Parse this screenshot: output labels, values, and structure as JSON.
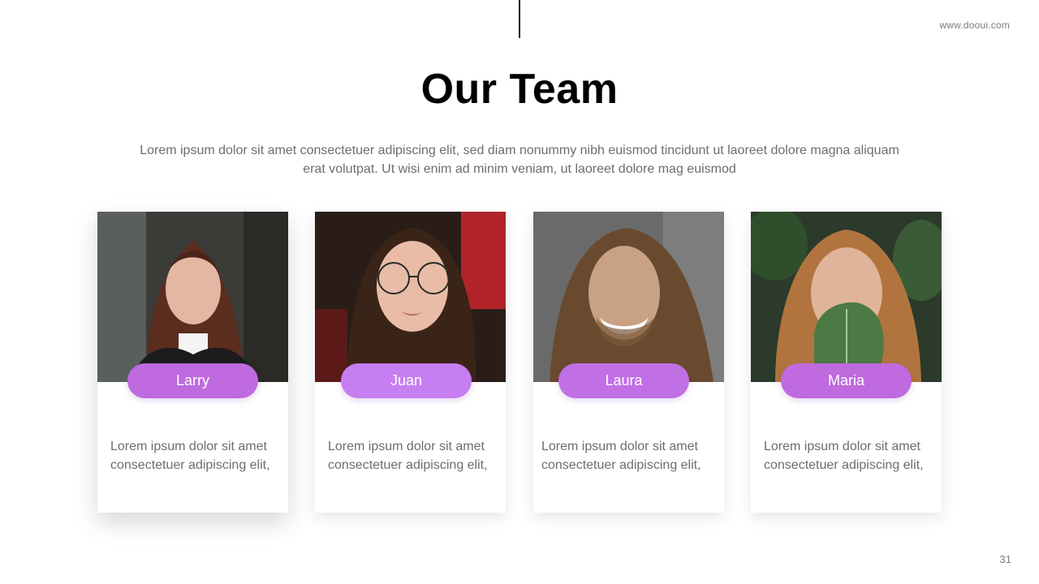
{
  "header": {
    "site_url": "www.dooui.com",
    "title": "Our Team",
    "intro_line1": "Lorem ipsum dolor sit amet consectetuer  adipiscing elit, sed diam nonummy  nibh euismod tincidunt  ut laoreet dolore magna aliquam",
    "intro_line2": "erat volutpat.  Ut wisi enim ad minim veniam,  ut laoreet dolore mag euismod"
  },
  "team": [
    {
      "name": "Larry",
      "desc_line1": "Lorem  ipsum  dolor  sit  amet",
      "desc_line2": "consectetuer  adipiscing elit,"
    },
    {
      "name": "Juan",
      "desc_line1": "Lorem  ipsum  dolor  sit  amet",
      "desc_line2": "consectetuer  adipiscing elit,"
    },
    {
      "name": "Laura",
      "desc_line1": "Lorem  ipsum  dolor  sit  amet",
      "desc_line2": "consectetuer  adipiscing elit,"
    },
    {
      "name": "Maria",
      "desc_line1": "Lorem  ipsum  dolor  sit  amet",
      "desc_line2": "consectetuer  adipiscing elit,"
    }
  ],
  "colors": {
    "accent": "#c06ce0",
    "text_gray": "#6d6d6d"
  },
  "footer": {
    "page_number": "31"
  }
}
